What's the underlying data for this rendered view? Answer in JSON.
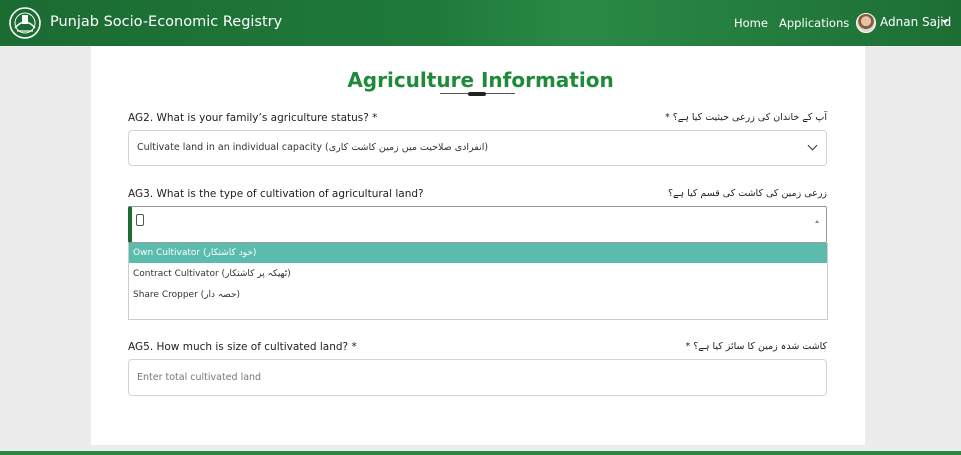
{
  "header": {
    "brand": "Punjab Socio-Economic Registry",
    "nav": {
      "home": "Home",
      "applications": "Applications"
    },
    "user_name": "Adnan Sajid"
  },
  "page": {
    "title": "Agriculture Information"
  },
  "questions": {
    "ag2": {
      "label": "AG2. What is your family’s agriculture status? *",
      "urdu": "آپ کے خاندان کی زرعی حیثیت کیا ہے؟ *",
      "selected": "Cultivate land in an individual capacity (انفرادی صلاحیت میں زمین کاشت کاری)"
    },
    "ag3": {
      "label": "AG3. What is the type of cultivation of agricultural land?",
      "urdu": "زرعی زمین کی کاشت کی قسم کیا ہے؟",
      "options": [
        "Own Cultivator (خود کاشتکار)",
        "Contract Cultivator (ٹھیکہ پر کاشتکار)",
        "Share Cropper (حصہ دار)"
      ]
    },
    "ag5": {
      "label": "AG5. How much is size of cultivated land? *",
      "urdu": "کاشت شدہ زمین کا سائز کیا ہے؟ *",
      "placeholder": "Enter total cultivated land"
    }
  },
  "colors": {
    "nav_green": "#1f7a3a",
    "title_green": "#1f8a3a",
    "highlight_teal": "#5bbcae"
  }
}
